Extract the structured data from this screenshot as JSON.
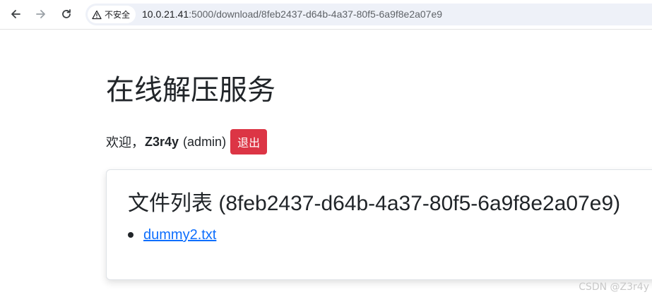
{
  "browser": {
    "security_label": "不安全",
    "url_host": "10.0.21.41",
    "url_rest": ":5000/download/8feb2437-d64b-4a37-80f5-6a9f8e2a07e9"
  },
  "page": {
    "title": "在线解压服务",
    "welcome_prefix": "欢迎，",
    "username": "Z3r4y",
    "role": "(admin)",
    "logout_label": "退出"
  },
  "files_card": {
    "title": "文件列表 (8feb2437-d64b-4a37-80f5-6a9f8e2a07e9)",
    "files": [
      {
        "name": "dummy2.txt"
      }
    ]
  },
  "watermark": "CSDN @Z3r4y",
  "colors": {
    "logout_bg": "#dc3545",
    "link": "#0d6efd"
  }
}
